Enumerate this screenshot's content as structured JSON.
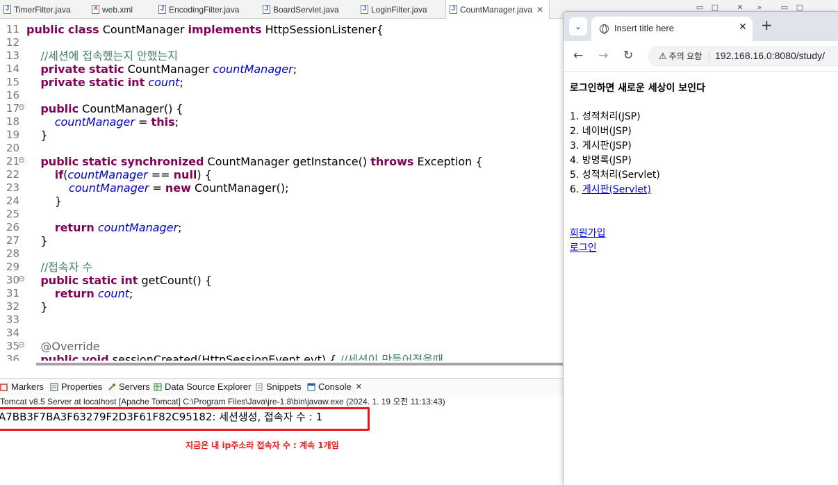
{
  "editor_tabs": [
    {
      "label": "TimerFilter.java",
      "type": "java"
    },
    {
      "label": "web.xml",
      "type": "xml"
    },
    {
      "label": "EncodingFilter.java",
      "type": "java"
    },
    {
      "label": "BoardServlet.java",
      "type": "java"
    },
    {
      "label": "LoginFilter.java",
      "type": "java"
    },
    {
      "label": "CountManager.java",
      "type": "java",
      "active": true
    }
  ],
  "code_lines": [
    {
      "n": "11",
      "html": "<span class=\"kw\">public</span> <span class=\"kw\">class</span> CountManager <span class=\"kw\">implements</span> HttpSessionListener{"
    },
    {
      "n": "12",
      "html": ""
    },
    {
      "n": "13",
      "html": "    <span class=\"cmt\">//세션에 접속했는지 안했는지</span>"
    },
    {
      "n": "14",
      "html": "    <span class=\"kw\">private</span> <span class=\"kw\">static</span> CountManager <span class=\"fld\">countManager</span>;"
    },
    {
      "n": "15",
      "html": "    <span class=\"kw\">private</span> <span class=\"kw\">static</span> <span class=\"kw\">int</span> <span class=\"fld\">count</span>;"
    },
    {
      "n": "16",
      "html": ""
    },
    {
      "n": "17",
      "fold": true,
      "html": "    <span class=\"kw\">public</span> CountManager() {"
    },
    {
      "n": "18",
      "html": "        <span class=\"fld\">countManager</span> = <span class=\"kw\">this</span>;"
    },
    {
      "n": "19",
      "html": "    }"
    },
    {
      "n": "20",
      "html": ""
    },
    {
      "n": "21",
      "fold": true,
      "html": "    <span class=\"kw\">public</span> <span class=\"kw\">static</span> <span class=\"kw\">synchronized</span> CountManager getInstance() <span class=\"kw\">throws</span> Exception {"
    },
    {
      "n": "22",
      "html": "        <span class=\"kw\">if</span>(<span class=\"fld\">countManager</span> == <span class=\"kw\">null</span>) {"
    },
    {
      "n": "23",
      "html": "            <span class=\"fld\">countManager</span> = <span class=\"kw\">new</span> CountManager();"
    },
    {
      "n": "24",
      "html": "        }"
    },
    {
      "n": "25",
      "html": ""
    },
    {
      "n": "26",
      "html": "        <span class=\"kw\">return</span> <span class=\"fld\">countManager</span>;"
    },
    {
      "n": "27",
      "html": "    }"
    },
    {
      "n": "28",
      "html": ""
    },
    {
      "n": "29",
      "html": "    <span class=\"cmt\">//접속자 수</span>"
    },
    {
      "n": "30",
      "fold": true,
      "html": "    <span class=\"kw\">public</span> <span class=\"kw\">static</span> <span class=\"kw\">int</span> getCount() {"
    },
    {
      "n": "31",
      "html": "        <span class=\"kw\">return</span> <span class=\"fld\">count</span>;"
    },
    {
      "n": "32",
      "html": "    }"
    },
    {
      "n": "33",
      "html": ""
    },
    {
      "n": "34",
      "html": ""
    },
    {
      "n": "35",
      "fold": true,
      "html": "    <span class=\"ann\">@Override</span>"
    },
    {
      "n": "36",
      "html": "    <span class=\"kw\">public</span> <span class=\"kw\">void</span> sessionCreated(HttpSessionEvent evt) { <span class=\"cmt\">//세션이 만들어졌을때</span>"
    }
  ],
  "views": [
    {
      "label": "Markers",
      "icon": "markers-icon",
      "color": "#c0392b"
    },
    {
      "label": "Properties",
      "icon": "properties-icon",
      "color": "#5a6e8c"
    },
    {
      "label": "Servers",
      "icon": "servers-icon",
      "color": "#8a6d3b"
    },
    {
      "label": "Data Source Explorer",
      "icon": "datasource-icon",
      "color": "#3c8a3c"
    },
    {
      "label": "Snippets",
      "icon": "snippets-icon",
      "color": "#7a7a7a"
    },
    {
      "label": "Console",
      "icon": "console-icon",
      "color": "#2a5ca8",
      "active": true
    }
  ],
  "console": {
    "header": "Tomcat v8.5 Server at localhost [Apache Tomcat] C:\\Program Files\\Java\\jre-1.8\\bin\\javaw.exe  (2024. 1. 19 오전 11:13:43)",
    "output": "A7BB3F7BA3F63279F2D3F61F82C95182: 세션생성, 접속자 수 : 1",
    "annotation": "지금은 내 ip주소라 접속자 수 :  계속 1개임"
  },
  "browser": {
    "tab_title": "Insert title here",
    "security_label": "주의 요함",
    "url": "192.168.16.0:8080/study/",
    "page": {
      "heading": "로그인하면 새로운 세상이 보인다",
      "menu": [
        {
          "text": "1. 성적처리(JSP)",
          "link": false
        },
        {
          "text": "2. 네이버(JSP)",
          "link": false
        },
        {
          "text": "3. 게시판(JSP)",
          "link": false
        },
        {
          "text": "4. 방명록(JSP)",
          "link": false
        },
        {
          "text": "5. 성적처리(Servlet)",
          "link": false
        },
        {
          "num": "6. ",
          "text": "게시판(Servlet)",
          "link": true
        }
      ],
      "links": [
        "회원가입",
        "로그인"
      ]
    }
  },
  "colors": {
    "highlight_box": "#e8181b",
    "link": "#0000ee",
    "keyword": "#7f0055",
    "field": "#0000c0",
    "comment": "#3f7f5f"
  }
}
